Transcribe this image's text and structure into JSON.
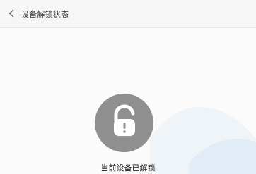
{
  "header": {
    "title": "设备解锁状态",
    "back_icon": "chevron-left-icon"
  },
  "main": {
    "status_text": "当前设备已解锁",
    "lock_icon": "unlocked-padlock-icon"
  },
  "colors": {
    "background": "#f6f6f6",
    "circle": "#8f8f8f",
    "watermark": "#6aa7e6"
  }
}
